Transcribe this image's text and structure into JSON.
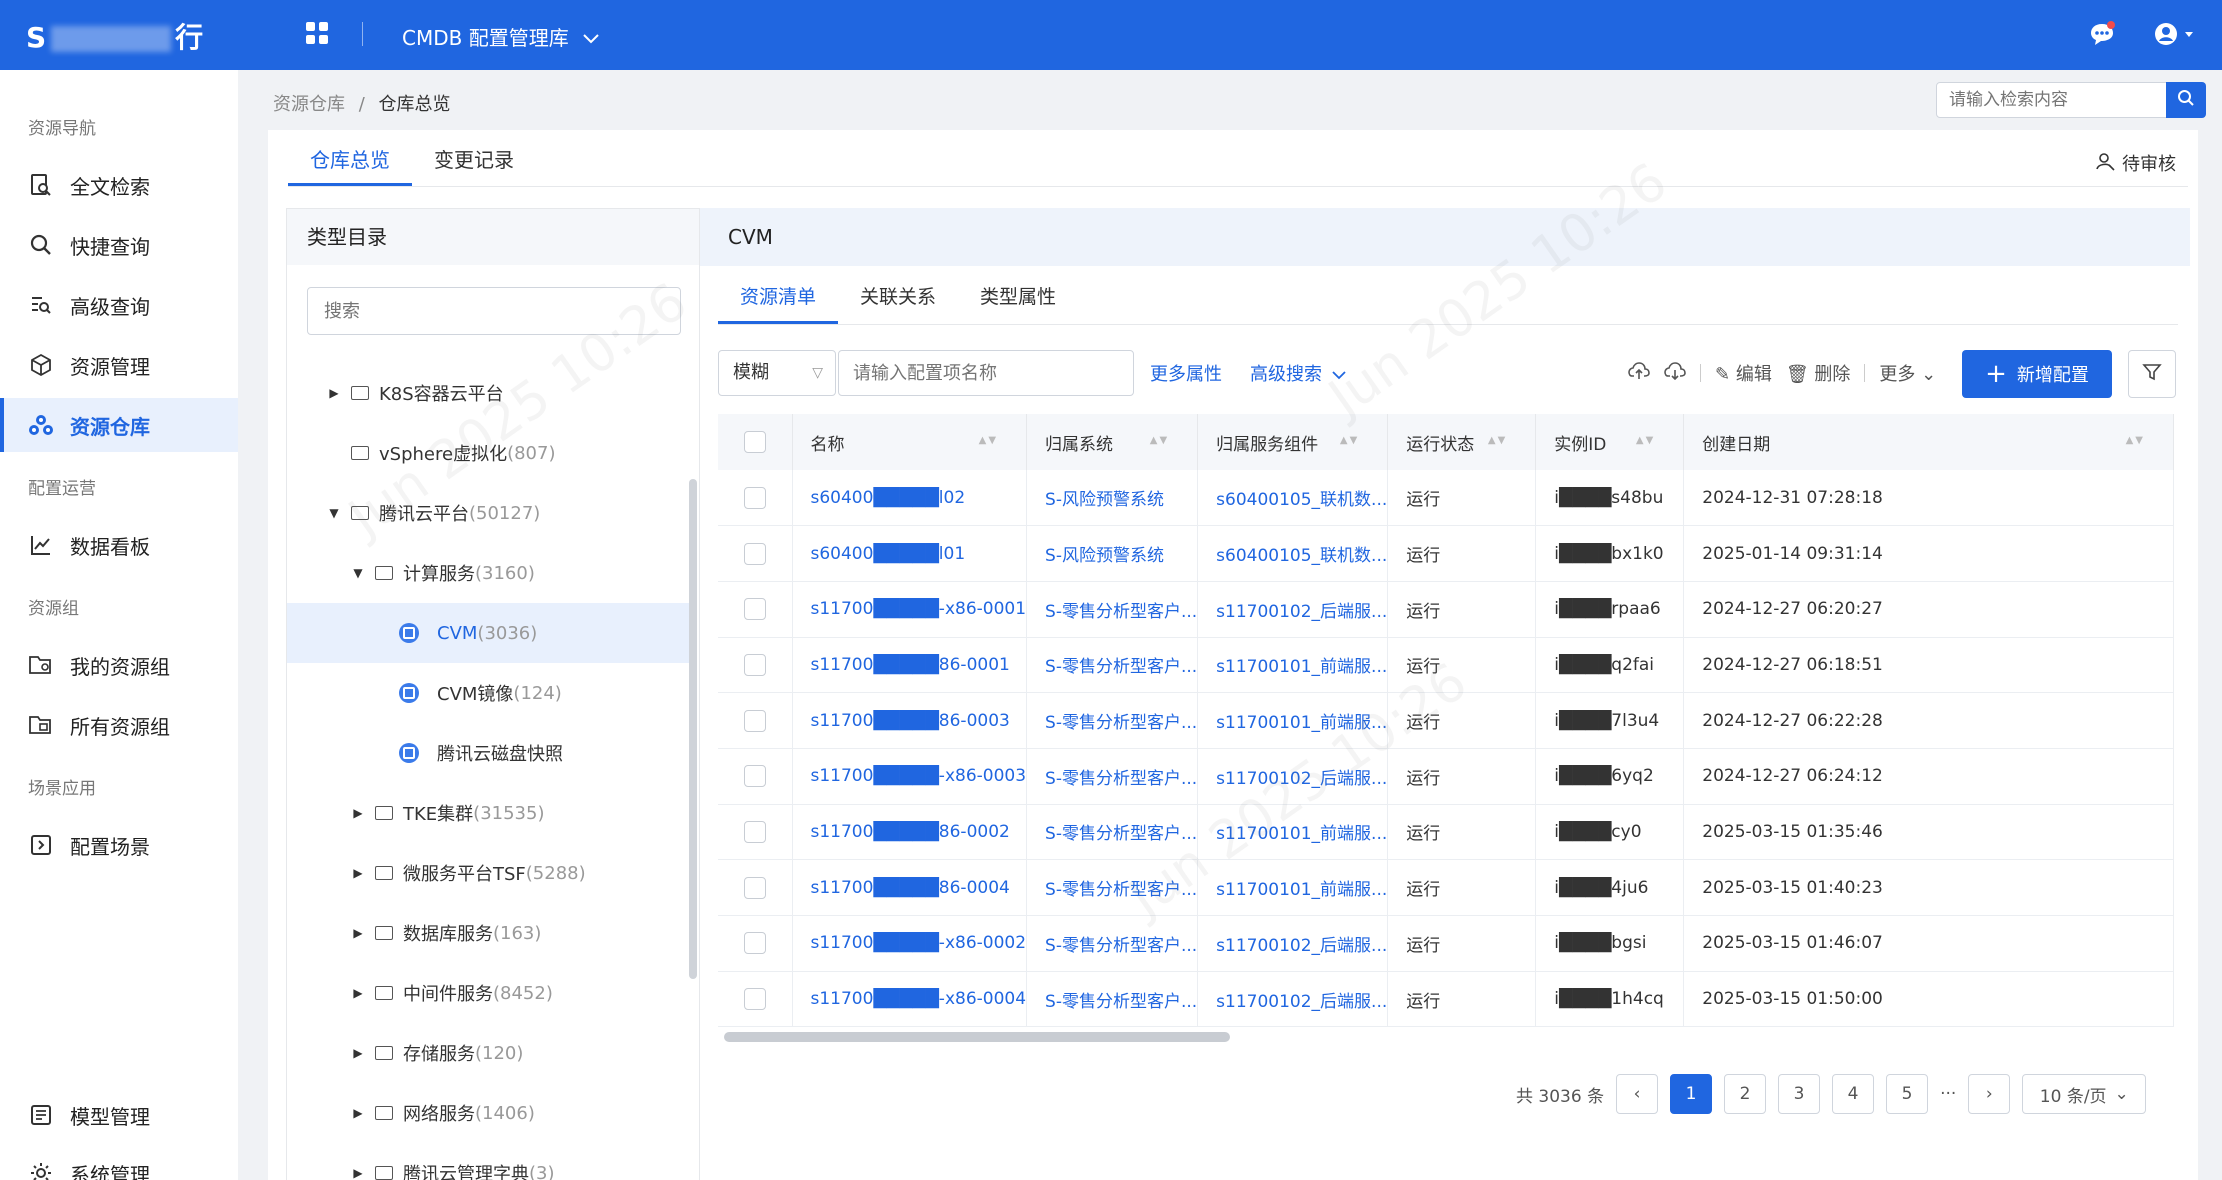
{
  "header": {
    "logo_prefix": "S",
    "logo_suffix": "行",
    "app_name": "CMDB 配置管理库",
    "app_icon": "grid-apps-icon",
    "icons": [
      "message-icon",
      "user-icon"
    ]
  },
  "sidebar": {
    "groups": {
      "nav": "资源导航",
      "ops": "配置运营",
      "rg": "资源组",
      "scene": "场景应用"
    },
    "items": [
      {
        "label": "全文检索",
        "icon": "doc-search-icon"
      },
      {
        "label": "快捷查询",
        "icon": "search-icon"
      },
      {
        "label": "高级查询",
        "icon": "list-search-icon"
      },
      {
        "label": "资源管理",
        "icon": "cube-icon"
      },
      {
        "label": "资源仓库",
        "icon": "cluster-icon"
      },
      {
        "label": "数据看板",
        "icon": "line-chart-icon"
      },
      {
        "label": "我的资源组",
        "icon": "my-group-icon"
      },
      {
        "label": "所有资源组",
        "icon": "all-groups-icon"
      },
      {
        "label": "配置场景",
        "icon": "scene-icon"
      },
      {
        "label": "模型管理",
        "icon": "model-icon"
      },
      {
        "label": "系统管理",
        "icon": "gear-icon"
      }
    ]
  },
  "breadcrumb": {
    "parent": "资源仓库",
    "sep": "/",
    "current": "仓库总览"
  },
  "global_search": {
    "placeholder": "请输入检索内容"
  },
  "main_tabs": [
    "仓库总览",
    "变更记录"
  ],
  "pending_review": "待审核",
  "tree": {
    "title": "类型目录",
    "search_placeholder": "搜索",
    "nodes": [
      {
        "label": "K8S容器云平台",
        "count": ""
      },
      {
        "label": "vSphere虚拟化",
        "count": "(807)"
      },
      {
        "label": "腾讯云平台",
        "count": "(50127)"
      },
      {
        "label": "计算服务",
        "count": "(3160)"
      },
      {
        "label": "CVM",
        "count": "(3036)"
      },
      {
        "label": "CVM镜像",
        "count": "(124)"
      },
      {
        "label": "腾讯云磁盘快照",
        "count": ""
      },
      {
        "label": "TKE集群",
        "count": "(31535)"
      },
      {
        "label": "微服务平台TSF",
        "count": "(5288)"
      },
      {
        "label": "数据库服务",
        "count": "(163)"
      },
      {
        "label": "中间件服务",
        "count": "(8452)"
      },
      {
        "label": "存储服务",
        "count": "(120)"
      },
      {
        "label": "网络服务",
        "count": "(1406)"
      },
      {
        "label": "腾讯云管理字典",
        "count": "(3)"
      }
    ]
  },
  "content": {
    "title": "CVM",
    "sub_tabs": [
      "资源清单",
      "关联关系",
      "类型属性"
    ],
    "filter": {
      "mode": "模糊",
      "placeholder": "请输入配置项名称",
      "more_attr": "更多属性",
      "adv_search": "高级搜索"
    },
    "toolbar": {
      "edit": "编辑",
      "delete": "删除",
      "more": "更多",
      "add": "新增配置"
    },
    "columns": [
      "名称",
      "归属系统",
      "归属服务组件",
      "运行状态",
      "实例ID",
      "创建日期"
    ],
    "rows": [
      [
        "s60400█████l02",
        "S-风险预警系统",
        "s60400105_联机数...",
        "运行",
        "i████s48bu",
        "2024-12-31 07:28:18"
      ],
      [
        "s60400█████l01",
        "S-风险预警系统",
        "s60400105_联机数...",
        "运行",
        "i████bx1k0",
        "2025-01-14 09:31:14"
      ],
      [
        "s11700█████-x86-0001",
        "S-零售分析型客户...",
        "s11700102_后端服...",
        "运行",
        "i████rpaa6",
        "2024-12-27 06:20:27"
      ],
      [
        "s11700█████86-0001",
        "S-零售分析型客户...",
        "s11700101_前端服...",
        "运行",
        "i████q2fai",
        "2024-12-27 06:18:51"
      ],
      [
        "s11700█████86-0003",
        "S-零售分析型客户...",
        "s11700101_前端服...",
        "运行",
        "i████7l3u4",
        "2024-12-27 06:22:28"
      ],
      [
        "s11700█████-x86-0003",
        "S-零售分析型客户...",
        "s11700102_后端服...",
        "运行",
        "i████6yq2",
        "2024-12-27 06:24:12"
      ],
      [
        "s11700█████86-0002",
        "S-零售分析型客户...",
        "s11700101_前端服...",
        "运行",
        "i████cy0",
        "2025-03-15 01:35:46"
      ],
      [
        "s11700█████86-0004",
        "S-零售分析型客户...",
        "s11700101_前端服...",
        "运行",
        "i████4ju6",
        "2025-03-15 01:40:23"
      ],
      [
        "s11700█████-x86-0002",
        "S-零售分析型客户...",
        "s11700102_后端服...",
        "运行",
        "i████bgsi",
        "2025-03-15 01:46:07"
      ],
      [
        "s11700█████-x86-0004",
        "S-零售分析型客户...",
        "s11700102_后端服...",
        "运行",
        "i████1h4cq",
        "2025-03-15 01:50:00"
      ]
    ],
    "pagination": {
      "total": "共 3036 条",
      "pages": [
        "1",
        "2",
        "3",
        "4",
        "5"
      ],
      "ellipsis": "···",
      "page_size": "10 条/页"
    }
  },
  "colors": {
    "primary": "#2066e0",
    "active_bg": "#e8f0fd"
  }
}
